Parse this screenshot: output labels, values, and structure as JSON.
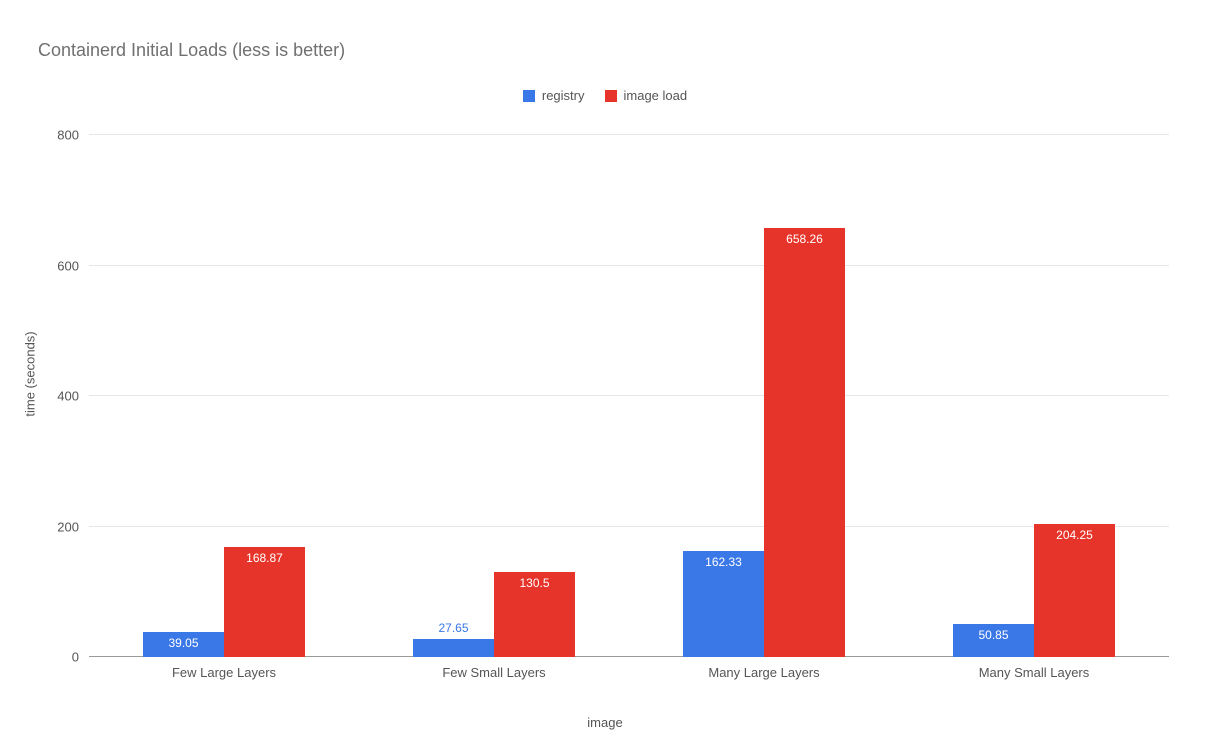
{
  "chart_data": {
    "type": "bar",
    "title": "Containerd Initial Loads (less is better)",
    "xlabel": "image",
    "ylabel": "time (seconds)",
    "ylim": [
      0,
      800
    ],
    "ytick_step": 200,
    "categories": [
      "Few Large Layers",
      "Few Small Layers",
      "Many Large Layers",
      "Many Small Layers"
    ],
    "series": [
      {
        "name": "registry",
        "color": "#3b78e7",
        "values": [
          39.05,
          27.65,
          162.33,
          50.85
        ]
      },
      {
        "name": "image load",
        "color": "#e6342a",
        "values": [
          168.87,
          130.5,
          658.26,
          204.25
        ]
      }
    ],
    "legend_position": "top"
  },
  "ytick_labels": {
    "0": "0",
    "1": "200",
    "2": "400",
    "3": "600",
    "4": "800"
  },
  "value_labels": {
    "g0s0": "39.05",
    "g0s1": "168.87",
    "g1s0": "27.65",
    "g1s1": "130.5",
    "g2s0": "162.33",
    "g2s1": "658.26",
    "g3s0": "50.85",
    "g3s1": "204.25"
  }
}
